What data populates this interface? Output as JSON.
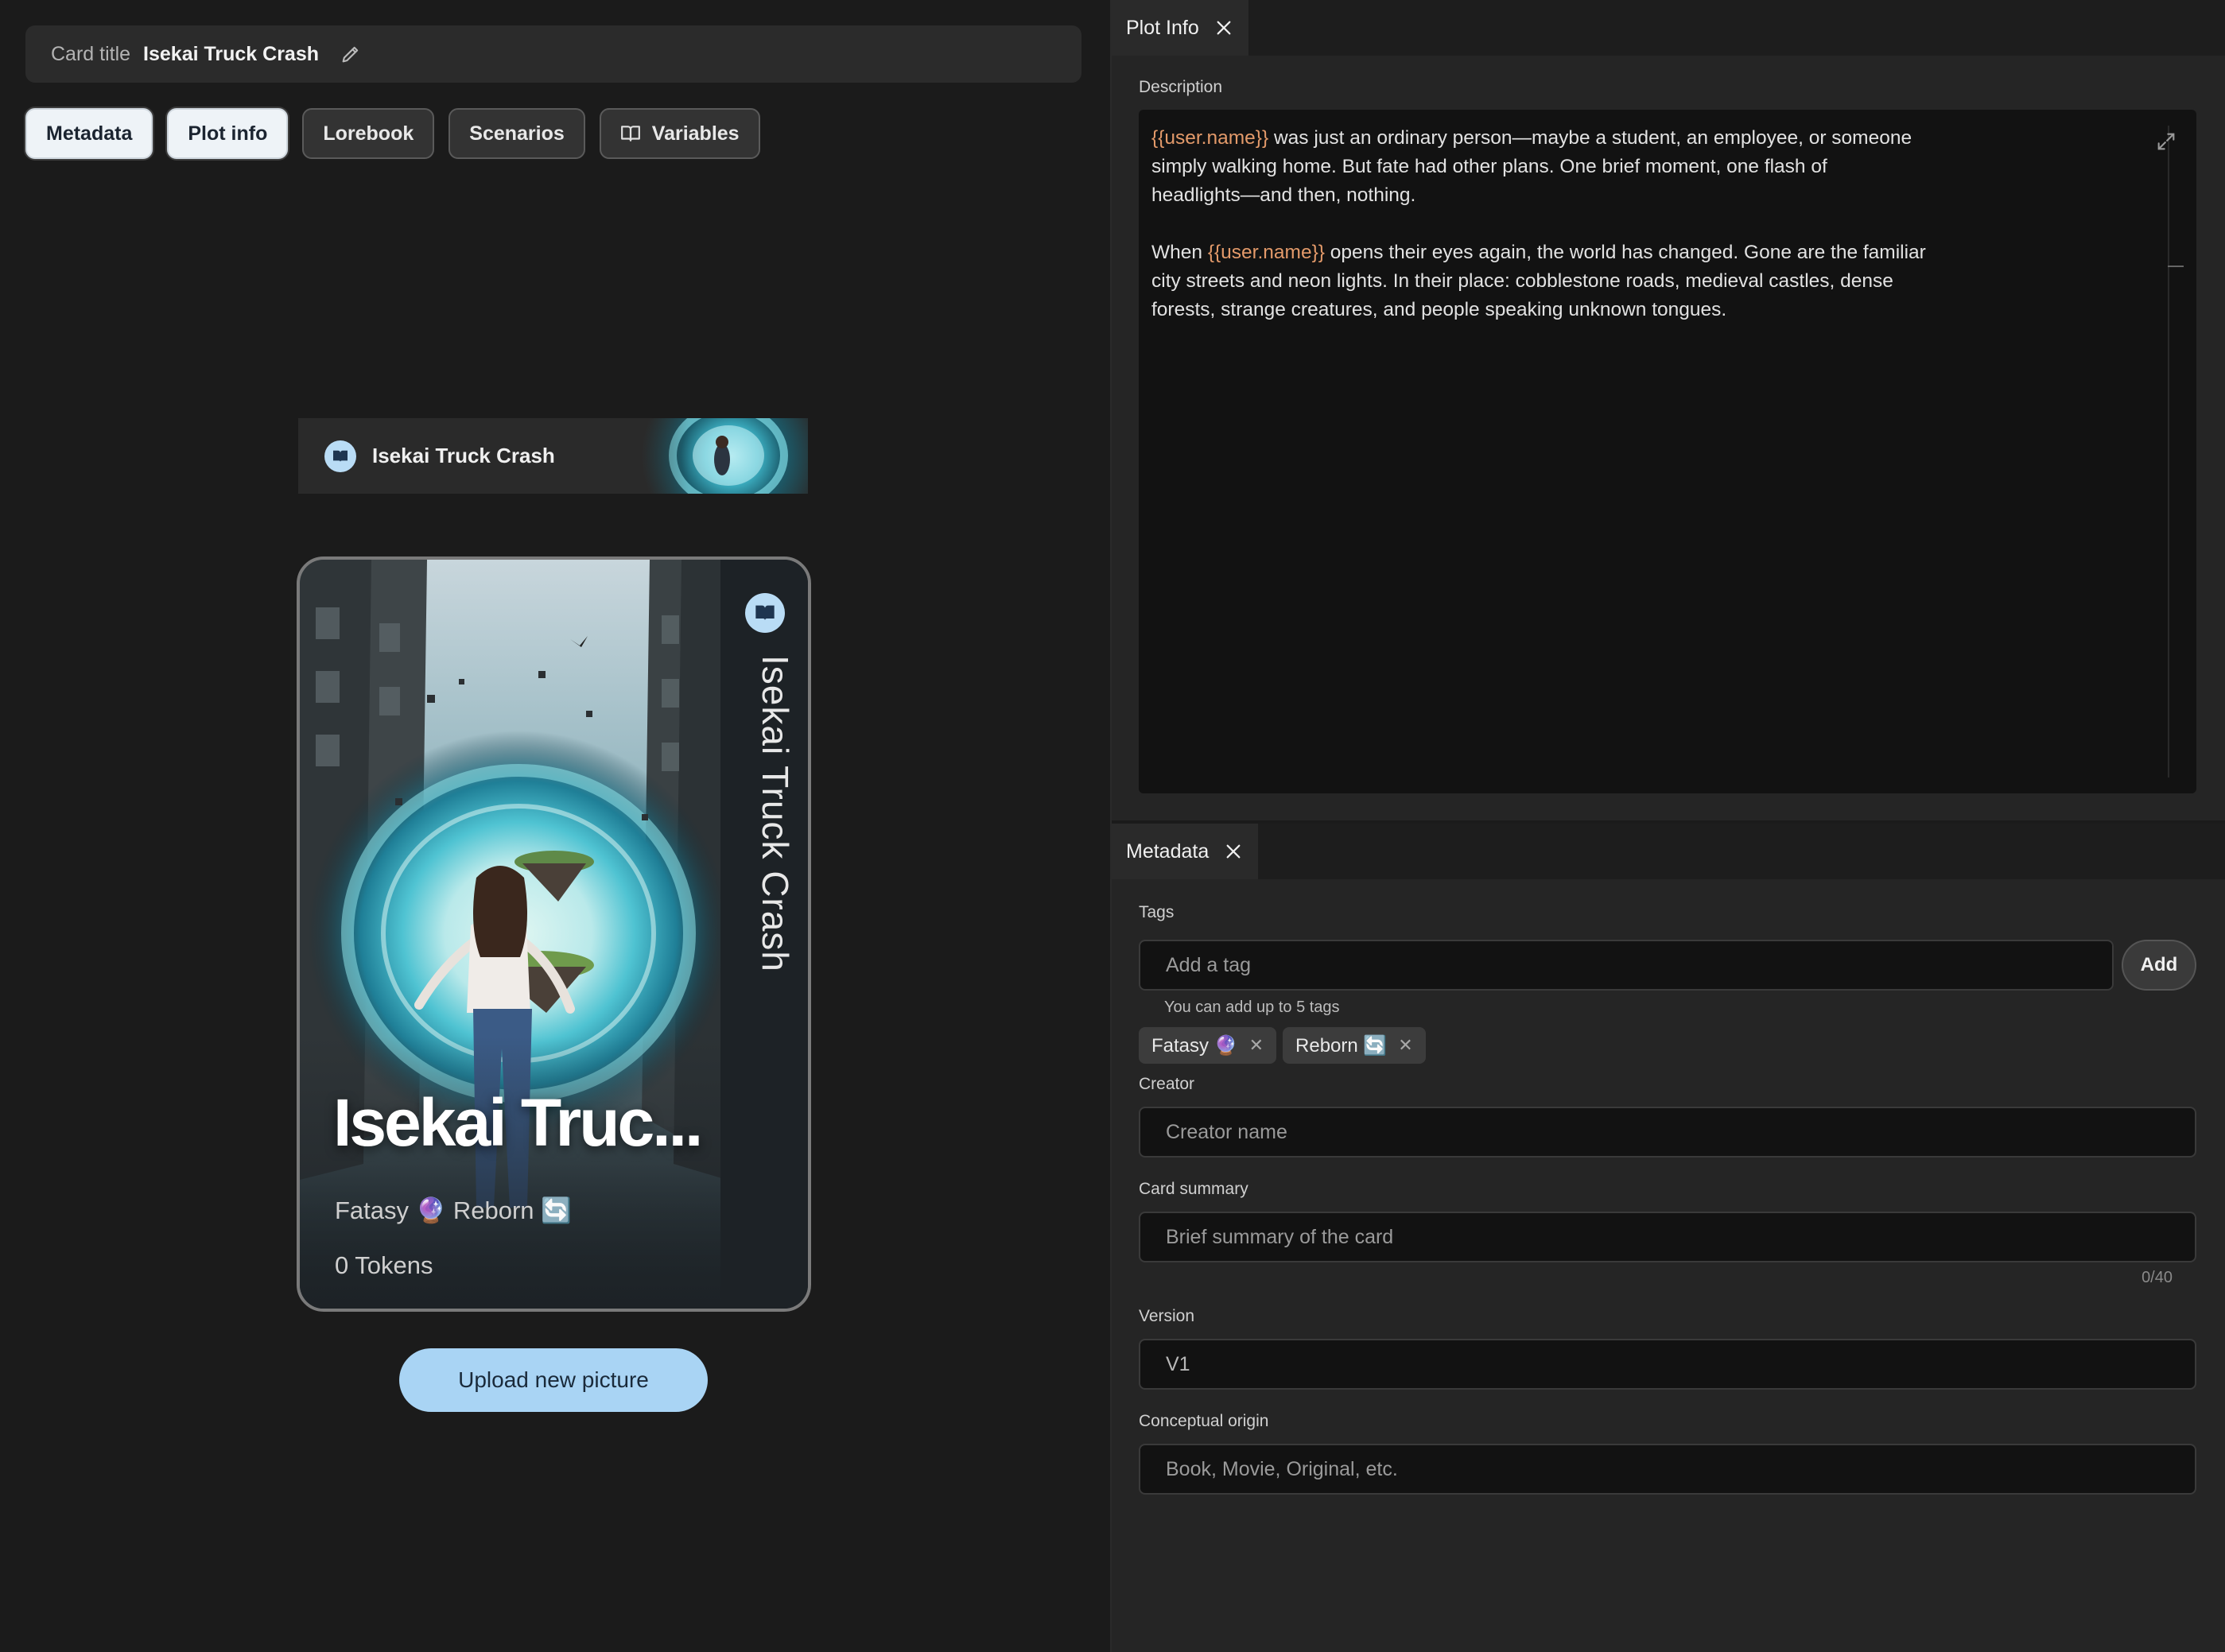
{
  "card_title": {
    "label": "Card title",
    "value": "Isekai Truck Crash"
  },
  "tabs": [
    {
      "label": "Metadata",
      "active": true
    },
    {
      "label": "Plot info",
      "active": true
    },
    {
      "label": "Lorebook",
      "active": false
    },
    {
      "label": "Scenarios",
      "active": false
    },
    {
      "label": "Variables",
      "active": false
    }
  ],
  "preview": {
    "strip_title": "Isekai Truck Crash",
    "vertical_title": "Isekai Truck Crash",
    "big_title": "Isekai Truc...",
    "tagline": "Fatasy 🔮 Reborn 🔄",
    "tokens": "0 Tokens",
    "upload_label": "Upload new picture"
  },
  "plot_info": {
    "tab_label": "Plot Info",
    "description_label": "Description",
    "paragraphs": [
      [
        {
          "text": "{{user.name}}",
          "var": true
        },
        {
          "text": " was just an ordinary person—maybe a student, an employee, or someone\nsimply walking home. But fate had other plans. One brief moment, one flash of\nheadlights—and then, nothing.",
          "var": false
        }
      ],
      [
        {
          "text": "When ",
          "var": false
        },
        {
          "text": "{{user.name}}",
          "var": true
        },
        {
          "text": " opens their eyes again, the world has changed. Gone are the familiar\ncity streets and neon lights. In their place: cobblestone roads, medieval castles, dense\nforests, strange creatures, and people speaking unknown tongues.",
          "var": false
        }
      ]
    ]
  },
  "metadata": {
    "tab_label": "Metadata",
    "tags_label": "Tags",
    "tag_placeholder": "Add a tag",
    "add_label": "Add",
    "tags_hint": "You can add up to 5 tags",
    "tags": [
      {
        "label": "Fatasy 🔮"
      },
      {
        "label": "Reborn 🔄"
      }
    ],
    "creator_label": "Creator",
    "creator_placeholder": "Creator name",
    "summary_label": "Card summary",
    "summary_placeholder": "Brief summary of the card",
    "summary_counter": "0/40",
    "version_label": "Version",
    "version_value": "V1",
    "origin_label": "Conceptual origin",
    "origin_placeholder": "Book, Movie, Original, etc."
  },
  "colors": {
    "accent": "#a9d4f4",
    "variable": "#e39a6a",
    "background": "#1b1b1b",
    "panel": "#252525"
  }
}
